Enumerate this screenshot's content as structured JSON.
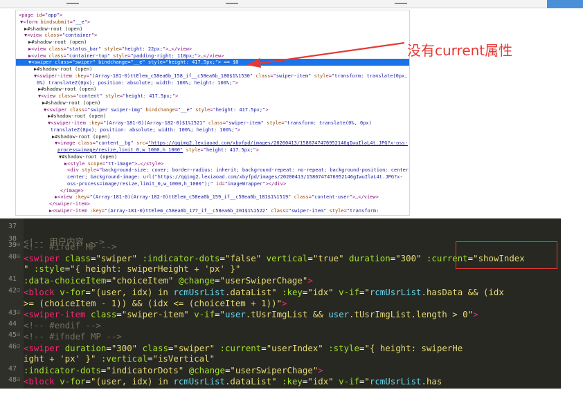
{
  "annotation": {
    "text": "没有current属性"
  },
  "devtools": {
    "lines": [
      [
        [
          "t-tag",
          "<page "
        ],
        [
          "t-attr",
          "id"
        ],
        [
          "t-tag",
          "="
        ],
        [
          "t-val",
          "\"app\""
        ],
        [
          "t-tag",
          ">"
        ]
      ],
      [
        [
          "t-tag",
          "▼<form "
        ],
        [
          "t-attr",
          "bindsubmit"
        ],
        [
          "t-tag",
          "="
        ],
        [
          "t-val",
          "\"__e\""
        ],
        [
          "t-tag",
          ">"
        ]
      ],
      [
        [
          "t-txt",
          "▶#shadow-root (open)"
        ]
      ],
      [
        [
          "t-tag",
          "▼<view "
        ],
        [
          "t-attr",
          "class"
        ],
        [
          "t-tag",
          "="
        ],
        [
          "t-val",
          "\"container\""
        ],
        [
          "t-tag",
          ">"
        ]
      ],
      [
        [
          "t-txt",
          "▶#shadow-root (open)"
        ]
      ],
      [
        [
          "t-tag",
          "▶<view "
        ],
        [
          "t-attr",
          "class"
        ],
        [
          "t-tag",
          "="
        ],
        [
          "t-val",
          "\"status_bar\" "
        ],
        [
          "t-attr",
          "style"
        ],
        [
          "t-tag",
          "="
        ],
        [
          "t-val",
          "\"height: 22px;\""
        ],
        [
          "t-tag",
          ">…</view>"
        ]
      ],
      [
        [
          "t-tag",
          "▶<view "
        ],
        [
          "t-attr",
          "class"
        ],
        [
          "t-tag",
          "="
        ],
        [
          "t-val",
          "\"container-top\" "
        ],
        [
          "t-attr",
          "style"
        ],
        [
          "t-tag",
          "="
        ],
        [
          "t-val",
          "\"padding-right: 110px;\""
        ],
        [
          "t-tag",
          ">…</view>"
        ]
      ],
      [
        [
          "t-tag",
          "▼<swiper "
        ],
        [
          "t-attr",
          "class"
        ],
        [
          "t-tag",
          "="
        ],
        [
          "t-val",
          "\"swiper\" "
        ],
        [
          "t-attr",
          "bindchange"
        ],
        [
          "t-tag",
          "="
        ],
        [
          "t-val",
          "\"__e\" "
        ],
        [
          "t-attr",
          "style"
        ],
        [
          "t-tag",
          "="
        ],
        [
          "t-val",
          "\"height: 417.5px;\""
        ],
        [
          "t-tag",
          ">"
        ],
        [
          "t-grey",
          " == $0"
        ]
      ],
      [
        [
          "t-txt",
          "▶#shadow-root (open)"
        ]
      ],
      [
        [
          "t-tag",
          "▼<swiper-item "
        ],
        [
          "t-attr",
          ":key"
        ],
        [
          "t-tag",
          "="
        ],
        [
          "t-val",
          "\"(Array-181-0)ttElem_c58ea6b_158_if__c58ea6b_180$1%1530\" "
        ],
        [
          "t-attr",
          "class"
        ],
        [
          "t-tag",
          "="
        ],
        [
          "t-val",
          "\"swiper-item\" "
        ],
        [
          "t-attr",
          "style"
        ],
        [
          "t-tag",
          "="
        ],
        [
          "t-val",
          "\"transform: translate(0px,"
        ]
      ],
      [
        [
          "t-val",
          "0%) translateZ(0px); position: absolute; width: 100%; height: 100%;\""
        ],
        [
          "t-tag",
          ">"
        ]
      ],
      [
        [
          "t-txt",
          "▶#shadow-root (open)"
        ]
      ],
      [
        [
          "t-tag",
          "▼<view "
        ],
        [
          "t-attr",
          "class"
        ],
        [
          "t-tag",
          "="
        ],
        [
          "t-val",
          "\"content\" "
        ],
        [
          "t-attr",
          "style"
        ],
        [
          "t-tag",
          "="
        ],
        [
          "t-val",
          "\"height: 417.5px;\""
        ],
        [
          "t-tag",
          ">"
        ]
      ],
      [
        [
          "t-txt",
          "▶#shadow-root (open)"
        ]
      ],
      [
        [
          "t-tag",
          "▼<swiper "
        ],
        [
          "t-attr",
          "class"
        ],
        [
          "t-tag",
          "="
        ],
        [
          "t-val",
          "\"swiper swiper-img\" "
        ],
        [
          "t-attr",
          "bindchange"
        ],
        [
          "t-tag",
          "="
        ],
        [
          "t-val",
          "\"__e\" "
        ],
        [
          "t-attr",
          "style"
        ],
        [
          "t-tag",
          "="
        ],
        [
          "t-val",
          "\"height: 417.5px;\""
        ],
        [
          "t-tag",
          ">"
        ]
      ],
      [
        [
          "t-txt",
          "▶#shadow-root (open)"
        ]
      ],
      [
        [
          "t-tag",
          "▼<swiper-item "
        ],
        [
          "t-attr",
          ":key"
        ],
        [
          "t-tag",
          "="
        ],
        [
          "t-val",
          "\"(Array-181-0)(Array-182-0)$1%1521\" "
        ],
        [
          "t-attr",
          "class"
        ],
        [
          "t-tag",
          "="
        ],
        [
          "t-val",
          "\"swiper-item\" "
        ],
        [
          "t-attr",
          "style"
        ],
        [
          "t-tag",
          "="
        ],
        [
          "t-val",
          "\"transform: translate(0%, 0px)"
        ]
      ],
      [
        [
          "t-val",
          "translateZ(0px); position: absolute; width: 100%; height: 100%;\""
        ],
        [
          "t-tag",
          ">"
        ]
      ],
      [
        [
          "t-txt",
          "▶#shadow-root (open)"
        ]
      ],
      [
        [
          "t-tag",
          "▼<image "
        ],
        [
          "t-attr",
          "class"
        ],
        [
          "t-tag",
          "="
        ],
        [
          "t-val",
          "\"content__bg\" "
        ],
        [
          "t-attr",
          "src"
        ],
        [
          "t-tag",
          "="
        ],
        [
          "t-link",
          "\"https://qqimg2.lexiaoad.com/xbyfpd/images/20200413/1586747476952146gIwuIlaL4t.JPG?x-oss-"
        ]
      ],
      [
        [
          "t-link",
          "process=image/resize,limit_0,w_1000,h_1000\""
        ],
        [
          "t-tag",
          " "
        ],
        [
          "t-attr",
          "style"
        ],
        [
          "t-tag",
          "="
        ],
        [
          "t-val",
          "\"height: 417.5px;\""
        ],
        [
          "t-tag",
          ">"
        ]
      ],
      [
        [
          "t-txt",
          "▼#shadow-root (open)"
        ]
      ],
      [
        [
          "t-tag",
          "▶<style "
        ],
        [
          "t-attr",
          "scope"
        ],
        [
          "t-tag",
          "="
        ],
        [
          "t-val",
          "\"tt-image\""
        ],
        [
          "t-tag",
          ">…</style>"
        ]
      ],
      [
        [
          "t-tag",
          "<div "
        ],
        [
          "t-attr",
          "style"
        ],
        [
          "t-tag",
          "="
        ],
        [
          "t-val",
          "\"background-size: cover; border-radius: inherit; background-repeat: no-repeat; background-position: center"
        ]
      ],
      [
        [
          "t-val",
          "center; background-image: url(\"https://qqimg2.lexiaoad.com/xbyfpd/images/20200413/1586747476952146gIwuIlaL4t.JPG?x-"
        ]
      ],
      [
        [
          "t-val",
          "oss-process=image/resize,limit_0,w_1000,h_1000\");\" "
        ],
        [
          "t-attr",
          "id"
        ],
        [
          "t-tag",
          "="
        ],
        [
          "t-val",
          "\"imageWrapper\""
        ],
        [
          "t-tag",
          "></div>"
        ]
      ],
      [
        [
          "t-tag",
          "</image>"
        ]
      ],
      [
        [
          "t-tag",
          "▶<view "
        ],
        [
          "t-attr",
          ":key"
        ],
        [
          "t-tag",
          "="
        ],
        [
          "t-val",
          "\"(Array-181-0)(Array-182-0)ttElem_c58ea6b_159_if__c58ea6b_181$1%1519\" "
        ],
        [
          "t-attr",
          "class"
        ],
        [
          "t-tag",
          "="
        ],
        [
          "t-val",
          "\"content-user\""
        ],
        [
          "t-tag",
          ">…</view>"
        ]
      ],
      [
        [
          "t-tag",
          "</swiper-item>"
        ]
      ],
      [
        [
          "t-tag",
          "▶<swiper-item "
        ],
        [
          "t-attr",
          ":key"
        ],
        [
          "t-tag",
          "="
        ],
        [
          "t-val",
          "\"(Array-181-0)ttElem_c58ea6b_177_if__c58ea6b_201$1%1522\" "
        ],
        [
          "t-attr",
          "class"
        ],
        [
          "t-tag",
          "="
        ],
        [
          "t-val",
          "\"swiper-item\" "
        ],
        [
          "t-attr",
          "style"
        ],
        [
          "t-tag",
          "="
        ],
        [
          "t-val",
          "\"transform:"
        ]
      ]
    ]
  },
  "editor": {
    "lines": [
      {
        "no": "37",
        "fold": "",
        "tokens": []
      },
      {
        "no": "38",
        "fold": "",
        "tokens": [
          [
            "c-p",
            "            "
          ],
          [
            "c-cmt",
            "<!-- 用户内容 -->"
          ]
        ]
      },
      {
        "no": "39",
        "fold": "⊟",
        "tokens": [
          [
            "c-p",
            "            "
          ],
          [
            "c-cmt",
            "<!-- #ifdef MP -->"
          ]
        ]
      },
      {
        "no": "40",
        "fold": "⊟",
        "tokens": [
          [
            "c-p",
            "            "
          ],
          [
            "c-tag",
            "<swiper "
          ],
          [
            "c-attr",
            "class"
          ],
          [
            "c-p",
            "="
          ],
          [
            "c-str",
            "\"swiper\" "
          ],
          [
            "c-attr",
            ":indicator-dots"
          ],
          [
            "c-p",
            "="
          ],
          [
            "c-str",
            "\"false\" "
          ],
          [
            "c-attr",
            "vertical"
          ],
          [
            "c-p",
            "="
          ],
          [
            "c-str",
            "\"true\" "
          ],
          [
            "c-attr",
            "duration"
          ],
          [
            "c-p",
            "="
          ],
          [
            "c-str",
            "\"300\" "
          ],
          [
            "c-attr",
            ":current"
          ],
          [
            "c-p",
            "="
          ],
          [
            "c-str",
            "\"showIndex"
          ]
        ]
      },
      {
        "no": "",
        "fold": "",
        "tokens": [
          [
            "c-str",
            "\" "
          ],
          [
            "c-attr",
            ":style"
          ],
          [
            "c-p",
            "="
          ],
          [
            "c-str",
            "\"{ height: swiperHeight + 'px' }\""
          ]
        ]
      },
      {
        "no": "41",
        "fold": "",
        "tokens": [
          [
            "c-p",
            "              "
          ],
          [
            "c-attr",
            ":data-choiceItem"
          ],
          [
            "c-p",
            "="
          ],
          [
            "c-str",
            "\"choiceItem\" "
          ],
          [
            "c-attr",
            "@change"
          ],
          [
            "c-p",
            "="
          ],
          [
            "c-str",
            "\"userSwiperChage\""
          ],
          [
            "c-tag",
            ">"
          ]
        ]
      },
      {
        "no": "42",
        "fold": "⊟",
        "tokens": [
          [
            "c-p",
            "                "
          ],
          [
            "c-tag",
            "<block "
          ],
          [
            "c-attr",
            "v-for"
          ],
          [
            "c-p",
            "="
          ],
          [
            "c-str",
            "\"(user, idx) in "
          ],
          [
            "c-kw",
            "rcmUsrList"
          ],
          [
            "c-str",
            ".dataList\" "
          ],
          [
            "c-attr",
            ":key"
          ],
          [
            "c-p",
            "="
          ],
          [
            "c-str",
            "\"idx\" "
          ],
          [
            "c-attr",
            "v-if"
          ],
          [
            "c-p",
            "="
          ],
          [
            "c-str",
            "\""
          ],
          [
            "c-kw",
            "rcmUsrList"
          ],
          [
            "c-str",
            ".hasData && (idx"
          ]
        ]
      },
      {
        "no": "",
        "fold": "",
        "tokens": [
          [
            "c-str",
            ">= (choiceItem - 1)) && (idx <= (choiceItem + 1))\""
          ],
          [
            "c-tag",
            ">"
          ]
        ]
      },
      {
        "no": "43",
        "fold": "⊟",
        "tokens": [
          [
            "c-p",
            "                  "
          ],
          [
            "c-tag",
            "<swiper-item "
          ],
          [
            "c-attr",
            "class"
          ],
          [
            "c-p",
            "="
          ],
          [
            "c-str",
            "\"swiper-item\" "
          ],
          [
            "c-attr",
            "v-if"
          ],
          [
            "c-p",
            "="
          ],
          [
            "c-str",
            "\""
          ],
          [
            "c-kw",
            "user"
          ],
          [
            "c-str",
            ".tUsrImgList && "
          ],
          [
            "c-kw",
            "user"
          ],
          [
            "c-str",
            ".tUsrImgList.length > 0\""
          ],
          [
            "c-tag",
            ">"
          ]
        ]
      },
      {
        "no": "44",
        "fold": "",
        "tokens": [
          [
            "c-p",
            "                    "
          ],
          [
            "c-cmt",
            "<!-- #endif -->"
          ]
        ]
      },
      {
        "no": "45",
        "fold": "⊟",
        "tokens": [
          [
            "c-p",
            "                    "
          ],
          [
            "c-cmt",
            "<!-- #ifndef MP -->"
          ]
        ]
      },
      {
        "no": "46",
        "fold": "⊟",
        "tokens": [
          [
            "c-p",
            "                    "
          ],
          [
            "c-tag",
            "<swiper "
          ],
          [
            "c-attr",
            "duration"
          ],
          [
            "c-p",
            "="
          ],
          [
            "c-str",
            "\"300\" "
          ],
          [
            "c-attr",
            "class"
          ],
          [
            "c-p",
            "="
          ],
          [
            "c-str",
            "\"swiper\" "
          ],
          [
            "c-attr",
            ":current"
          ],
          [
            "c-p",
            "="
          ],
          [
            "c-str",
            "\"userIndex\" "
          ],
          [
            "c-attr",
            ":style"
          ],
          [
            "c-p",
            "="
          ],
          [
            "c-str",
            "\"{ height: swiperHe"
          ]
        ]
      },
      {
        "no": "",
        "fold": "",
        "tokens": [
          [
            "c-str",
            "ight + 'px' }\" "
          ],
          [
            "c-attr",
            ":vertical"
          ],
          [
            "c-p",
            "="
          ],
          [
            "c-str",
            "\"isVertical\""
          ]
        ]
      },
      {
        "no": "47",
        "fold": "",
        "tokens": [
          [
            "c-p",
            "                      "
          ],
          [
            "c-attr",
            ":indicator-dots"
          ],
          [
            "c-p",
            "="
          ],
          [
            "c-str",
            "\"indicatorDots\" "
          ],
          [
            "c-attr",
            "@change"
          ],
          [
            "c-p",
            "="
          ],
          [
            "c-str",
            "\"userSwiperChage\""
          ],
          [
            "c-tag",
            ">"
          ]
        ]
      },
      {
        "no": "48",
        "fold": "⊟",
        "tokens": [
          [
            "c-p",
            "                        "
          ],
          [
            "c-tag",
            "<block "
          ],
          [
            "c-attr",
            "v-for"
          ],
          [
            "c-p",
            "="
          ],
          [
            "c-str",
            "\"(user, idx) in "
          ],
          [
            "c-kw",
            "rcmUsrList"
          ],
          [
            "c-str",
            ".dataList\" "
          ],
          [
            "c-attr",
            ":key"
          ],
          [
            "c-p",
            "="
          ],
          [
            "c-str",
            "\"idx\" "
          ],
          [
            "c-attr",
            "v-if"
          ],
          [
            "c-p",
            "="
          ],
          [
            "c-str",
            "\""
          ],
          [
            "c-kw",
            "rcmUsrList"
          ],
          [
            "c-str",
            ".has"
          ]
        ]
      }
    ]
  }
}
